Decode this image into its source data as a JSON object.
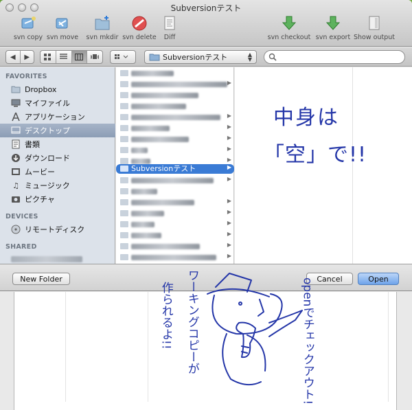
{
  "window": {
    "title": "Subversionテスト"
  },
  "toolbar": {
    "items": [
      {
        "label": "svn copy"
      },
      {
        "label": "svn move"
      },
      {
        "label": "svn mkdir"
      },
      {
        "label": "svn delete"
      },
      {
        "label": "Diff"
      },
      {
        "label": "svn checkout"
      },
      {
        "label": "svn export"
      },
      {
        "label": "Show output"
      }
    ]
  },
  "navbar": {
    "back_glyph": "◀",
    "forward_glyph": "▶",
    "path_popup": "Subversionテスト",
    "search_placeholder": ""
  },
  "sidebar": {
    "favorites_header": "FAVORITES",
    "favorites": [
      {
        "label": "Dropbox",
        "icon": "folder-icon"
      },
      {
        "label": "マイファイル",
        "icon": "files-icon"
      },
      {
        "label": "アプリケーション",
        "icon": "applications-icon"
      },
      {
        "label": "デスクトップ",
        "icon": "desktop-icon",
        "selected": true
      },
      {
        "label": "書類",
        "icon": "documents-icon"
      },
      {
        "label": "ダウンロード",
        "icon": "downloads-icon"
      },
      {
        "label": "ムービー",
        "icon": "movies-icon"
      },
      {
        "label": "ミュージック",
        "icon": "music-icon"
      },
      {
        "label": "ピクチャ",
        "icon": "pictures-icon"
      }
    ],
    "devices_header": "DEVICES",
    "devices": [
      {
        "label": "リモートディスク",
        "icon": "disc-icon"
      }
    ],
    "shared_header": "SHARED"
  },
  "browser": {
    "selected_folder": "Subversionテスト"
  },
  "bottombar": {
    "new_folder": "New Folder",
    "cancel": "Cancel",
    "open": "Open"
  },
  "annotations": {
    "note1_line1": "中身は",
    "note1_line2": "「空」で!!",
    "note2": "openでチェックアウト!",
    "note3": "ワーキングコピーが",
    "note4": "作られるよ!!"
  },
  "colors": {
    "selection": "#3a7bd5",
    "sidebar_bg": "#dce2ea",
    "ink": "#2436a8"
  }
}
